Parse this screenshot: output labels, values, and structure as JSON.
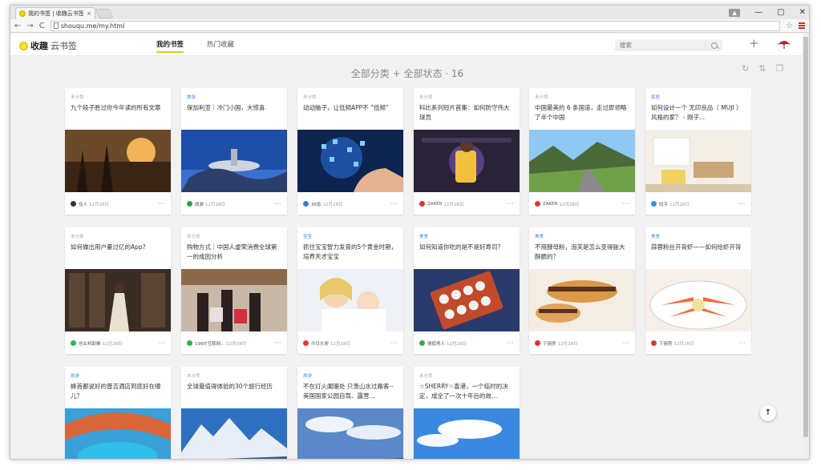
{
  "browser": {
    "tab_title": "我的书签 | 收趣云书签",
    "tab_close": "×",
    "url": "shouqu.me/my.html",
    "win_min": "—",
    "win_max": "▢",
    "win_close": "✕"
  },
  "header": {
    "logo_bold": "收趣",
    "logo_rest": "云书签",
    "tabs": [
      {
        "label": "我的书签",
        "active": true
      },
      {
        "label": "热门收藏",
        "active": false
      }
    ],
    "search_placeholder": "搜索",
    "add_label": "+"
  },
  "heading": "全部分类 + 全部状态 · 16",
  "colors": {
    "accent": "#f2c600",
    "category_blue": "#4a8ad8"
  },
  "cards": [
    {
      "category": "未分类",
      "title": "九个段子胜过你今年读的所有文章",
      "source": "佳人",
      "date": "12月28日",
      "icon_color": "#333333"
    },
    {
      "category": "旅游",
      "title": "保加利亚｜冷门小国，大惊喜",
      "source": "旅游",
      "date": "12月28日",
      "icon_color": "#2e9e4a"
    },
    {
      "category": "未分类",
      "title": "动动脑子，让低频APP不 “低频”",
      "source": "36氪",
      "date": "12月28日",
      "icon_color": "#3a7bd5"
    },
    {
      "category": "未分类",
      "title": "科比系列短片首集：如何防守伟大球员",
      "source": "ZAKER",
      "date": "12月28日",
      "icon_color": "#d23a3a"
    },
    {
      "category": "未分类",
      "title": "中国最美的 6 条国道，走过即领略了半个中国",
      "source": "ZAKER",
      "date": "12月28日",
      "icon_color": "#d23a3a"
    },
    {
      "category": "家居",
      "title": "如何设计一个 无印良品（ MUJI ）风格的家？ - 刚子...",
      "source": "知乎",
      "date": "12月28日",
      "icon_color": "#3a8de0"
    },
    {
      "category": "未分类",
      "title": "如何做出用户量过亿的App?",
      "source": "创业邦助推",
      "date": "12月28日",
      "icon_color": "#36b04a"
    },
    {
      "category": "未分类",
      "title": "购物方式｜中国人虚荣消费全球第一的成因分析",
      "source": "199IT互联网...",
      "date": "12月28日",
      "icon_color": "#36b04a"
    },
    {
      "category": "宝宝",
      "title": "抓住宝宝智力发育的5个黄金时期，培养天才宝宝",
      "source": "今日头条",
      "date": "12月28日",
      "icon_color": "#e03a3a"
    },
    {
      "category": "美食",
      "title": "如何知道你吃的是不是好寿司？",
      "source": "搜狐男人",
      "date": "12月28日",
      "icon_color": "#36b04a"
    },
    {
      "category": "美食",
      "title": "不用酵母粉，泡芙是怎么变得胀大酥脆的？",
      "source": "下厨房",
      "date": "12月28日",
      "icon_color": "#d23a3a"
    },
    {
      "category": "美食",
      "title": "蒜蓉粉丝开背虾——如何给虾开背",
      "source": "下厨房",
      "date": "12月28日",
      "icon_color": "#d23a3a"
    },
    {
      "category": "旅游",
      "title": "蜂首都说好的普吉酒店到底好在哪儿？",
      "source": "",
      "date": "",
      "icon_color": ""
    },
    {
      "category": "未分类",
      "title": "全球最值得体验的30个旅行经历",
      "source": "",
      "date": "",
      "icon_color": ""
    },
    {
      "category": "旅游",
      "title": "不在灯火阑珊处 只羡山水过路客--美国国家公园自驾、露营...",
      "source": "",
      "date": "",
      "icon_color": ""
    },
    {
      "category": "未分类",
      "title": "☆SHERRY☆香港，一个临时的决定，成全了一次十年后的故...",
      "source": "",
      "date": "",
      "icon_color": ""
    }
  ],
  "more_label": "···",
  "to_top": "↑"
}
